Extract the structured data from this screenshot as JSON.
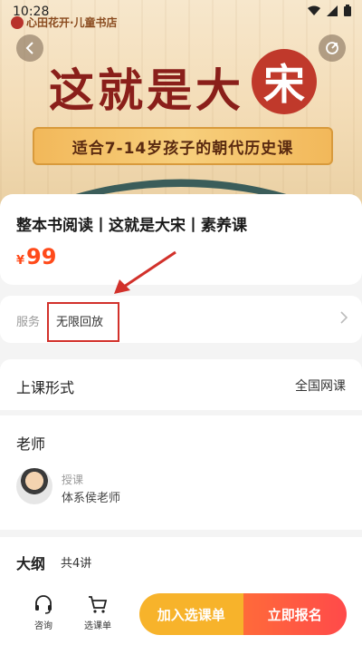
{
  "status": {
    "time": "10:28"
  },
  "brand": {
    "name": "心田花开·儿童书店"
  },
  "hero": {
    "title": "这就是大",
    "seal_char": "宋",
    "ribbon": "适合7-14岁孩子的朝代历史课"
  },
  "course": {
    "title": "整本书阅读丨这就是大宋丨素养课",
    "currency": "¥",
    "price": "99"
  },
  "service": {
    "label": "服务",
    "value": "无限回放"
  },
  "format": {
    "label": "上课形式",
    "value": "全国网课"
  },
  "teacher": {
    "section_title": "老师",
    "role": "授课",
    "name": "体系侯老师"
  },
  "outline": {
    "title": "大纲",
    "count": "共4讲"
  },
  "bottom": {
    "consult_label": "咨询",
    "cart_label": "选课单",
    "add_button": "加入选课单",
    "join_button": "立即报名"
  },
  "colors": {
    "accent": "#ff4a1a",
    "cta_yellow": "#f7b32b",
    "cta_red": "#ff4a4a",
    "highlight": "#d2312b"
  }
}
